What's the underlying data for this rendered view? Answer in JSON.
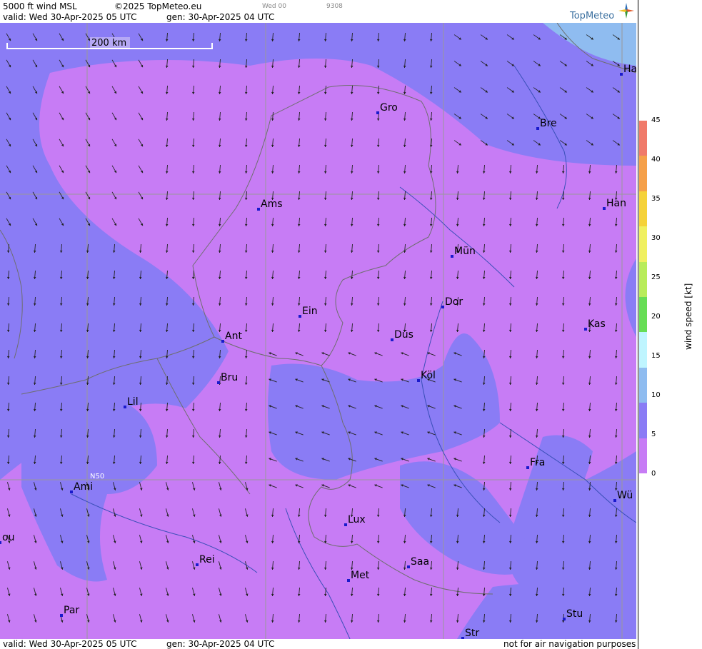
{
  "header": {
    "product": "5000 ft wind MSL",
    "copyright": "©2025 TopMeteo.eu",
    "day_hour": "Wed 00",
    "code": "9308",
    "valid_line": "valid:  Wed  30-Apr-2025  05 UTC",
    "gen_line": "gen: 30-Apr-2025 04 UTC",
    "logo": "TopMeteo"
  },
  "map": {
    "scale_label": "200 km",
    "lat_label": "N50",
    "colors": {
      "speed_0_5": "#c77cf5",
      "speed_5_10": "#8a7cf5",
      "speed_10_15": "#8fbcf0",
      "grid": "#999999",
      "border": "#6e6e6e",
      "river": "#3a4fb8",
      "city_marker": "#1a1acc"
    },
    "cities": [
      {
        "name": "Gro"
      },
      {
        "name": "Bre"
      },
      {
        "name": "Ha"
      },
      {
        "name": "Ams"
      },
      {
        "name": "Han"
      },
      {
        "name": "Mün"
      },
      {
        "name": "Dor"
      },
      {
        "name": "Ein"
      },
      {
        "name": "Ant"
      },
      {
        "name": "Düs"
      },
      {
        "name": "Kas"
      },
      {
        "name": "Bru"
      },
      {
        "name": "Köl"
      },
      {
        "name": "Lil"
      },
      {
        "name": "Fra"
      },
      {
        "name": "Ami"
      },
      {
        "name": "Wü"
      },
      {
        "name": "Lux"
      },
      {
        "name": "ou"
      },
      {
        "name": "Rei"
      },
      {
        "name": "Saa"
      },
      {
        "name": "Met"
      },
      {
        "name": "Par"
      },
      {
        "name": "Stu"
      },
      {
        "name": "Str"
      }
    ]
  },
  "legend": {
    "title": "wind  speed  [kt]",
    "ticks": [
      "45",
      "40",
      "35",
      "30",
      "25",
      "20",
      "15",
      "10",
      "5",
      "0"
    ],
    "colors": [
      "#f07a6a",
      "#f5a04a",
      "#f5d23a",
      "#f0f060",
      "#b8ec5a",
      "#66dd55",
      "#bff5ff",
      "#8fbcf0",
      "#8a7cf5",
      "#c77cf5"
    ]
  },
  "footer": {
    "valid_line": "valid:  Wed  30-Apr-2025  05 UTC",
    "gen_line": "gen: 30-Apr-2025 04 UTC",
    "disclaimer": "not for air navigation purposes"
  }
}
